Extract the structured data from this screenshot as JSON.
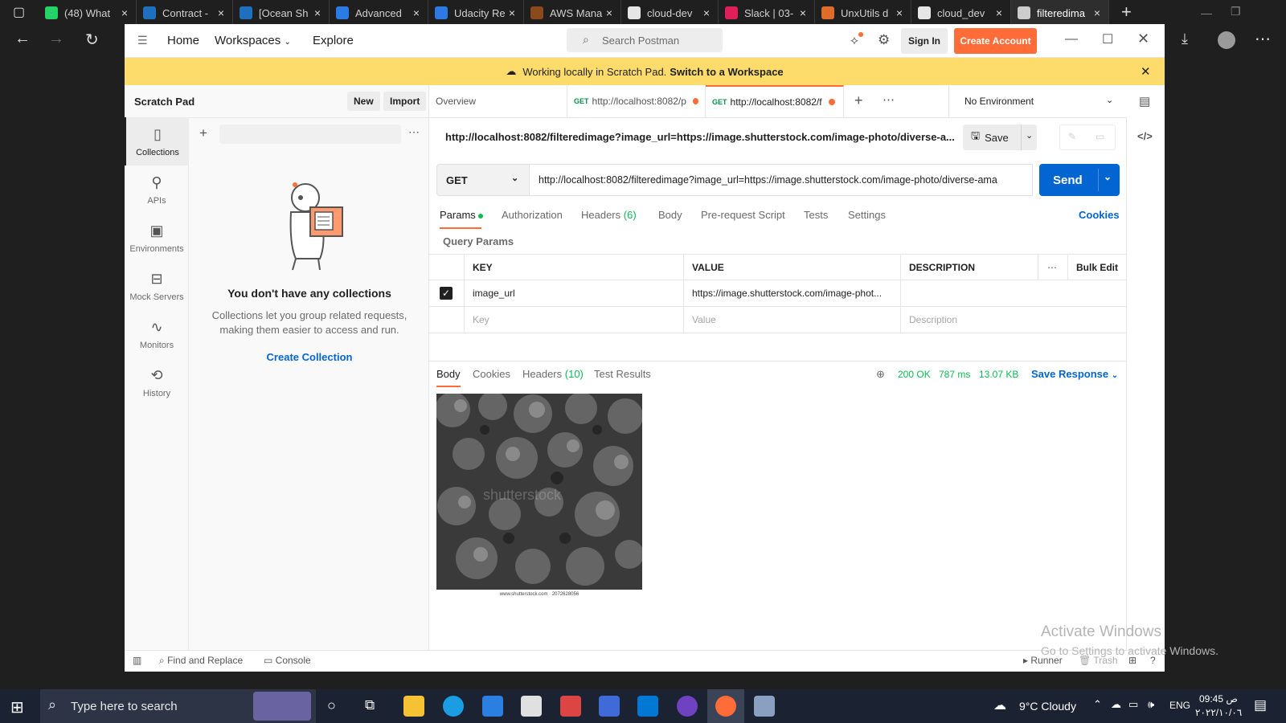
{
  "browser": {
    "tabs": [
      {
        "label": "(48) What",
        "color": "#25d366"
      },
      {
        "label": "Contract -",
        "color": "#1f6fbf"
      },
      {
        "label": "[Ocean Sh",
        "color": "#1f6fbf"
      },
      {
        "label": "Advanced",
        "color": "#2c7be5"
      },
      {
        "label": "Udacity Re",
        "color": "#2c7be5"
      },
      {
        "label": "AWS Mana",
        "color": "#8b4a1c"
      },
      {
        "label": "cloud-dev",
        "color": "#e6e6e6"
      },
      {
        "label": "Slack | 03-",
        "color": "#e01e5a"
      },
      {
        "label": "UnxUtils d",
        "color": "#e06c2a"
      },
      {
        "label": "cloud_dev",
        "color": "#e6e6e6"
      },
      {
        "label": "filteredima",
        "color": "#cccccc"
      }
    ],
    "close": "×",
    "new_tab": "+"
  },
  "header": {
    "home": "Home",
    "workspaces": "Workspaces",
    "explore": "Explore",
    "search_placeholder": "Search Postman",
    "sign_in": "Sign In",
    "create_account": "Create Account"
  },
  "banner": {
    "text": "Working locally in Scratch Pad.",
    "link": "Switch to a Workspace"
  },
  "sidebar": {
    "title": "Scratch Pad",
    "new": "New",
    "import": "Import",
    "rail": [
      {
        "label": "Collections",
        "icon": "collections-icon"
      },
      {
        "label": "APIs",
        "icon": "apis-icon"
      },
      {
        "label": "Environments",
        "icon": "environments-icon"
      },
      {
        "label": "Mock Servers",
        "icon": "mock-servers-icon"
      },
      {
        "label": "Monitors",
        "icon": "monitors-icon"
      },
      {
        "label": "History",
        "icon": "history-icon"
      }
    ],
    "empty_title": "You don't have any collections",
    "empty_desc_1": "Collections let you group related requests,",
    "empty_desc_2": "making them easier to access and run.",
    "create_collection": "Create Collection"
  },
  "tabs": {
    "overview": "Overview",
    "req1_method": "GET",
    "req1_label": "http://localhost:8082/p",
    "req2_method": "GET",
    "req2_label": "http://localhost:8082/f",
    "environment": "No Environment"
  },
  "request": {
    "title": "http://localhost:8082/filteredimage?image_url=https://image.shutterstock.com/image-photo/diverse-a...",
    "save": "Save",
    "method": "GET",
    "url": "http://localhost:8082/filteredimage?image_url=https://image.shutterstock.com/image-photo/diverse-ama",
    "send": "Send",
    "subtabs": [
      "Params",
      "Authorization",
      "Headers",
      "Body",
      "Pre-request Script",
      "Tests",
      "Settings"
    ],
    "headers_count": "(6)",
    "cookies": "Cookies",
    "query_params_title": "Query Params",
    "table_headers": {
      "key": "KEY",
      "value": "VALUE",
      "description": "DESCRIPTION",
      "bulk_edit": "Bulk Edit"
    },
    "params": [
      {
        "key": "image_url",
        "value": "https://image.shutterstock.com/image-phot...",
        "description": ""
      }
    ],
    "placeholders": {
      "key": "Key",
      "value": "Value",
      "description": "Description"
    }
  },
  "response": {
    "tabs": [
      "Body",
      "Cookies",
      "Headers",
      "Test Results"
    ],
    "headers_count": "(10)",
    "status": "200 OK",
    "time": "787 ms",
    "size": "13.07 KB",
    "save_response": "Save Response",
    "image_caption": "www.shutterstock.com · 2072628056",
    "image_watermark": "shutterstock"
  },
  "footer": {
    "find_replace": "Find and Replace",
    "console": "Console",
    "runner": "Runner",
    "trash": "Trash"
  },
  "watermark": {
    "line1": "Activate Windows",
    "line2": "Go to Settings to activate Windows."
  },
  "taskbar": {
    "search_placeholder": "Type here to search",
    "weather": "9°C  Cloudy",
    "lang": "ENG",
    "time": "09:45 ص",
    "date": "٢٠٢٢/١٠/٠٦"
  }
}
